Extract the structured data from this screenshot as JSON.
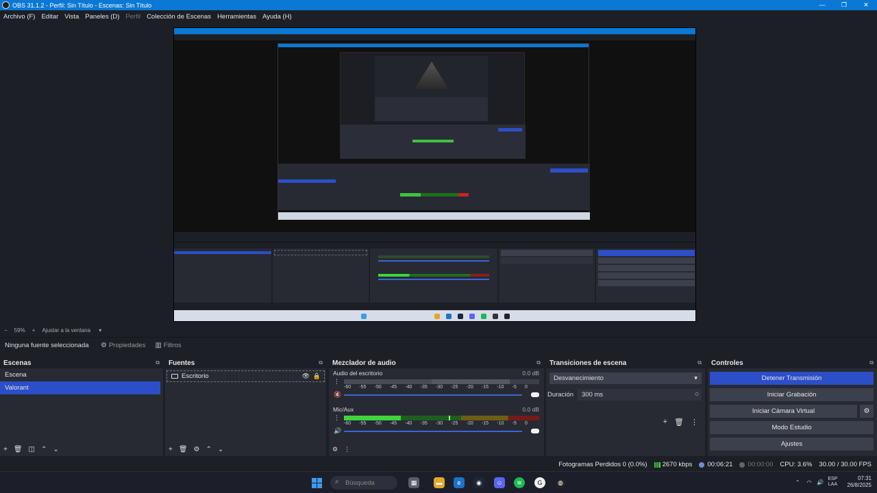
{
  "window": {
    "title": "OBS 31.1.2 - Perfil: Sin Título - Escenas: Sin Título",
    "controls": [
      "—",
      "❐",
      "✕"
    ]
  },
  "menu": [
    "Archivo (F)",
    "Editar",
    "Vista",
    "Paneles (D)",
    "Perfil",
    "Colección de Escenas",
    "Herramientas",
    "Ayuda (H)"
  ],
  "zoom": {
    "minus": "−",
    "value": "59%",
    "plus": "+",
    "fit": "Ajustar a la ventana"
  },
  "source_toolbar": {
    "none_selected": "Ninguna fuente seleccionada",
    "properties": "Propiedades",
    "filters": "Filtros"
  },
  "scenes": {
    "title": "Escenas",
    "items": [
      "Escena",
      "Valorant"
    ],
    "selected_index": 1
  },
  "sources": {
    "title": "Fuentes",
    "items": [
      "Escritorio"
    ]
  },
  "mixer": {
    "title": "Mezclador de audio",
    "ticks": [
      "-60",
      "-55",
      "-50",
      "-45",
      "-40",
      "-35",
      "-30",
      "-25",
      "-20",
      "-15",
      "-10",
      "-5",
      "0"
    ],
    "channels": [
      {
        "name": "Audio del escritorio",
        "db": "0.0 dB",
        "muted": true,
        "level": 0.0
      },
      {
        "name": "Mic/Aux",
        "db": "0.0 dB",
        "muted": false,
        "level": 0.29
      }
    ]
  },
  "transitions": {
    "title": "Transiciones de escena",
    "selected": "Desvanecimiento",
    "duration_label": "Duración",
    "duration_value": "300 ms"
  },
  "controls": {
    "title": "Controles",
    "stop_stream": "Detener Transmisión",
    "start_recording": "Iniciar Grabación",
    "virtual_camera": "Iniciar Cámara Virtual",
    "studio_mode": "Modo Estudio",
    "settings": "Ajustes"
  },
  "status": {
    "dropped_frames": "Fotogramas Perdidos 0 (0.0%)",
    "bitrate": "2670 kbps",
    "stream_time": "00:06:21",
    "rec_time": "00:00:00",
    "cpu": "CPU: 3.6%",
    "fps": "30.00 / 30.00 FPS"
  },
  "taskbar": {
    "search": "Búsqueda",
    "lang_1": "ESP",
    "lang_2": "LAA",
    "time": "07:31",
    "date": "26/8/2025"
  },
  "colors": {
    "accent": "#2c4ec7",
    "titlebar": "#0a78d4",
    "meter_green": "#3fc43f"
  }
}
